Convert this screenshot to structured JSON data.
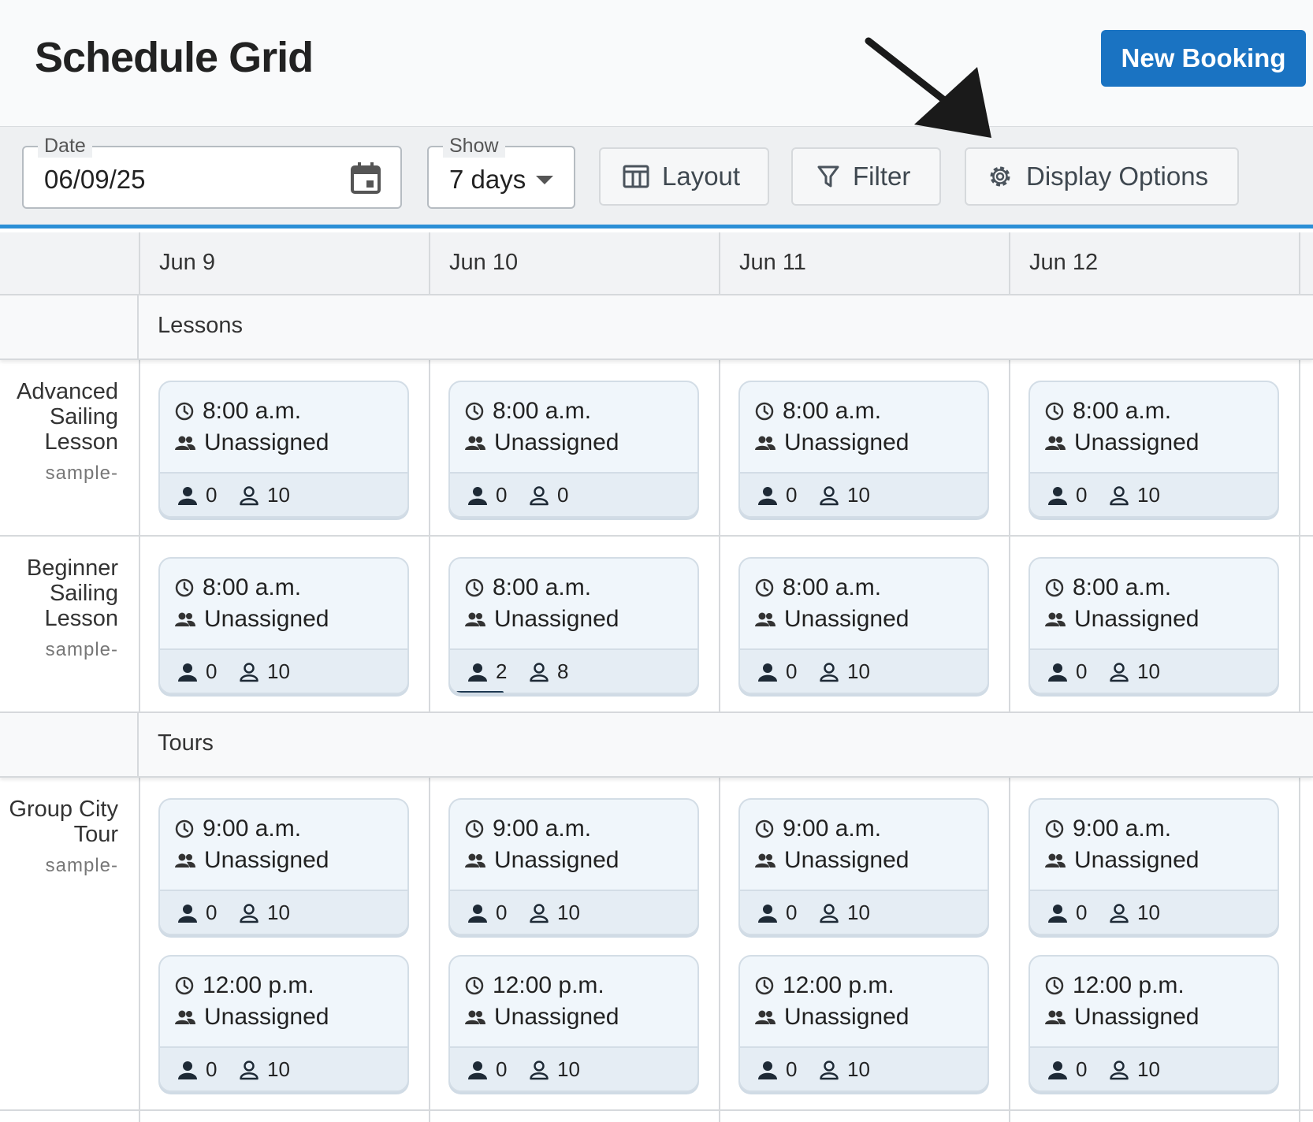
{
  "header": {
    "title": "Schedule Grid",
    "new_booking_label": "New Booking"
  },
  "toolbar": {
    "date_legend": "Date",
    "date_value": "06/09/25",
    "show_legend": "Show",
    "show_value": "7 days",
    "layout_label": "Layout",
    "filter_label": "Filter",
    "display_options_label": "Display Options"
  },
  "grid": {
    "days": [
      "Jun 9",
      "Jun 10",
      "Jun 11",
      "Jun 12"
    ],
    "sections": [
      {
        "label": "Lessons",
        "rows": [
          {
            "name": "Advanced Sailing Lesson",
            "sub": "sample-",
            "slots": [
              [
                {
                  "time": "8:00 a.m.",
                  "assignee": "Unassigned",
                  "booked": "0",
                  "available": "10",
                  "fill": 0
                }
              ],
              [
                {
                  "time": "8:00 a.m.",
                  "assignee": "Unassigned",
                  "booked": "0",
                  "available": "0",
                  "fill": 0
                }
              ],
              [
                {
                  "time": "8:00 a.m.",
                  "assignee": "Unassigned",
                  "booked": "0",
                  "available": "10",
                  "fill": 0
                }
              ],
              [
                {
                  "time": "8:00 a.m.",
                  "assignee": "Unassigned",
                  "booked": "0",
                  "available": "10",
                  "fill": 0
                }
              ]
            ]
          },
          {
            "name": "Beginner Sailing Lesson",
            "sub": "sample-",
            "slots": [
              [
                {
                  "time": "8:00 a.m.",
                  "assignee": "Unassigned",
                  "booked": "0",
                  "available": "10",
                  "fill": 0
                }
              ],
              [
                {
                  "time": "8:00 a.m.",
                  "assignee": "Unassigned",
                  "booked": "2",
                  "available": "8",
                  "fill": 0.2
                }
              ],
              [
                {
                  "time": "8:00 a.m.",
                  "assignee": "Unassigned",
                  "booked": "0",
                  "available": "10",
                  "fill": 0
                }
              ],
              [
                {
                  "time": "8:00 a.m.",
                  "assignee": "Unassigned",
                  "booked": "0",
                  "available": "10",
                  "fill": 0
                }
              ]
            ]
          }
        ]
      },
      {
        "label": "Tours",
        "rows": [
          {
            "name": "Group City Tour",
            "sub": "sample-",
            "slots": [
              [
                {
                  "time": "9:00 a.m.",
                  "assignee": "Unassigned",
                  "booked": "0",
                  "available": "10",
                  "fill": 0
                },
                {
                  "time": "12:00 p.m.",
                  "assignee": "Unassigned",
                  "booked": "0",
                  "available": "10",
                  "fill": 0
                }
              ],
              [
                {
                  "time": "9:00 a.m.",
                  "assignee": "Unassigned",
                  "booked": "0",
                  "available": "10",
                  "fill": 0
                },
                {
                  "time": "12:00 p.m.",
                  "assignee": "Unassigned",
                  "booked": "0",
                  "available": "10",
                  "fill": 0
                }
              ],
              [
                {
                  "time": "9:00 a.m.",
                  "assignee": "Unassigned",
                  "booked": "0",
                  "available": "10",
                  "fill": 0
                },
                {
                  "time": "12:00 p.m.",
                  "assignee": "Unassigned",
                  "booked": "0",
                  "available": "10",
                  "fill": 0
                }
              ],
              [
                {
                  "time": "9:00 a.m.",
                  "assignee": "Unassigned",
                  "booked": "0",
                  "available": "10",
                  "fill": 0
                },
                {
                  "time": "12:00 p.m.",
                  "assignee": "Unassigned",
                  "booked": "0",
                  "available": "10",
                  "fill": 0
                }
              ]
            ]
          }
        ]
      }
    ]
  },
  "icons": {
    "calendar": "calendar-icon",
    "dropdown": "chevron-down-icon",
    "layout": "table-layout-icon",
    "filter": "filter-icon",
    "display_options": "gear-icon",
    "clock": "clock-icon",
    "people": "people-icon",
    "booked": "person-filled-icon",
    "available": "person-outline-icon",
    "annotation_arrow": "arrow-icon"
  },
  "colors": {
    "accent": "#1a73c2",
    "toolbar_border": "#2b8fd6",
    "card_bg": "#f0f6fb",
    "progress": "#1f3a52"
  }
}
